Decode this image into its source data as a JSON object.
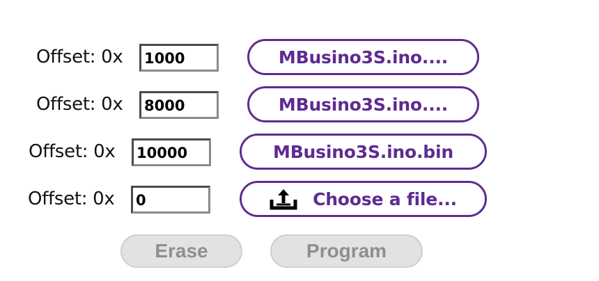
{
  "rows": [
    {
      "label": "Offset: 0x",
      "offset_value": "1000",
      "file_label": "MBusino3S.ino...."
    },
    {
      "label": "Offset: 0x",
      "offset_value": "8000",
      "file_label": "MBusino3S.ino...."
    },
    {
      "label": "Offset: 0x",
      "offset_value": "10000",
      "file_label": "MBusino3S.ino.bin"
    },
    {
      "label": "Offset: 0x",
      "offset_value": "0",
      "file_label": "Choose a file...",
      "icon": "upload-icon"
    }
  ],
  "actions": {
    "erase_label": "Erase",
    "program_label": "Program"
  },
  "colors": {
    "accent": "#5e2b91",
    "disabled_bg": "#e2e2e2",
    "disabled_text": "#8f8f8f"
  }
}
